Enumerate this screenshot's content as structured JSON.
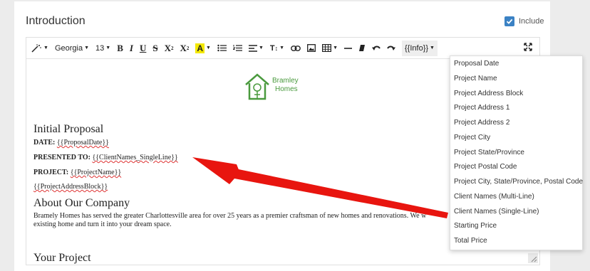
{
  "section": {
    "title": "Introduction",
    "include_label": "Include",
    "include_checked": true
  },
  "toolbar": {
    "font_family": "Georgia",
    "font_size": "13",
    "bold": "B",
    "italic": "I",
    "underline": "U",
    "strikethrough": "S",
    "superscript": "X",
    "subscript": "X",
    "font_color": "A",
    "text_size": "T",
    "info_menu": "{{Info}}"
  },
  "logo": {
    "line1": "Bramley",
    "line2": "Homes",
    "color": "#4a9a3e"
  },
  "document": {
    "heading": "Initial Proposal",
    "date_label": "DATE:",
    "date_value": "{{ProposalDate}}",
    "presented_label": "PRESENTED TO:",
    "presented_value": "{{ClientNames_SingleLine}}",
    "project_label": "PROJECT:",
    "project_value": "{{ProjectName}}",
    "address_block": "{{ProjectAddressBlock}}",
    "about_heading": "About Our Company",
    "about_para_1": "Bramely Homes has served the greater Charlottesville area for over 25 years as a premier craftsman of new homes and renovations.  We w",
    "about_para_2": "existing home and turn it into your dream space.",
    "your_project_heading": "Your Project"
  },
  "dropdown": {
    "items": [
      "Proposal Date",
      "Project Name",
      "Project Address Block",
      "Project Address 1",
      "Project Address 2",
      "Project City",
      "Project State/Province",
      "Project Postal Code",
      "Project City, State/Province, Postal Code",
      "Client Names (Multi-Line)",
      "Client Names (Single-Line)",
      "Starting Price",
      "Total Price"
    ]
  },
  "colors": {
    "accent": "#3b82c4",
    "arrow": "#e8150f",
    "highlight": "#f3e800"
  }
}
